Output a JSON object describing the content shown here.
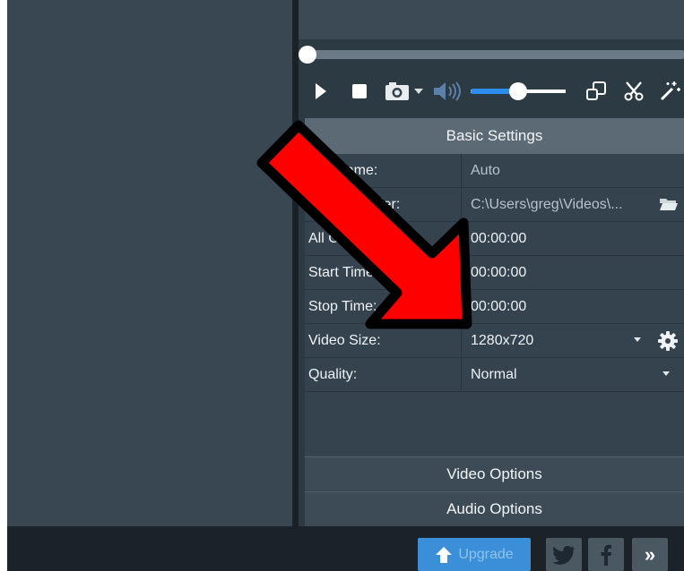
{
  "player": {
    "icons": [
      "play-icon",
      "stop-icon",
      "camera-icon",
      "chevron-down-icon",
      "speaker-icon",
      "popout-icon",
      "scissors-icon",
      "magic-wand-icon"
    ],
    "volume_level": 0.5,
    "seek_position": 0.0
  },
  "basic_settings": {
    "header": "Basic Settings",
    "rows": [
      {
        "label": "File Name:",
        "value": "Auto"
      },
      {
        "label": "Output Folder:",
        "value": "C:\\Users\\greg\\Videos\\..."
      },
      {
        "label": "All Conversion:",
        "value": "00:00:00"
      },
      {
        "label": "Start Time:",
        "value": "00:00:00"
      },
      {
        "label": "Stop Time:",
        "value": "00:00:00"
      },
      {
        "label": "Video Size:",
        "value": "1280x720"
      },
      {
        "label": "Quality:",
        "value": "Normal"
      }
    ]
  },
  "sections": {
    "video_options": "Video Options",
    "audio_options": "Audio Options"
  },
  "footer": {
    "upgrade_label": "Upgrade",
    "more_label": "»"
  },
  "colors": {
    "accent": "#2d8ef0",
    "upgrade": "#3a8fd8",
    "annotation_arrow": "#ff0000"
  }
}
